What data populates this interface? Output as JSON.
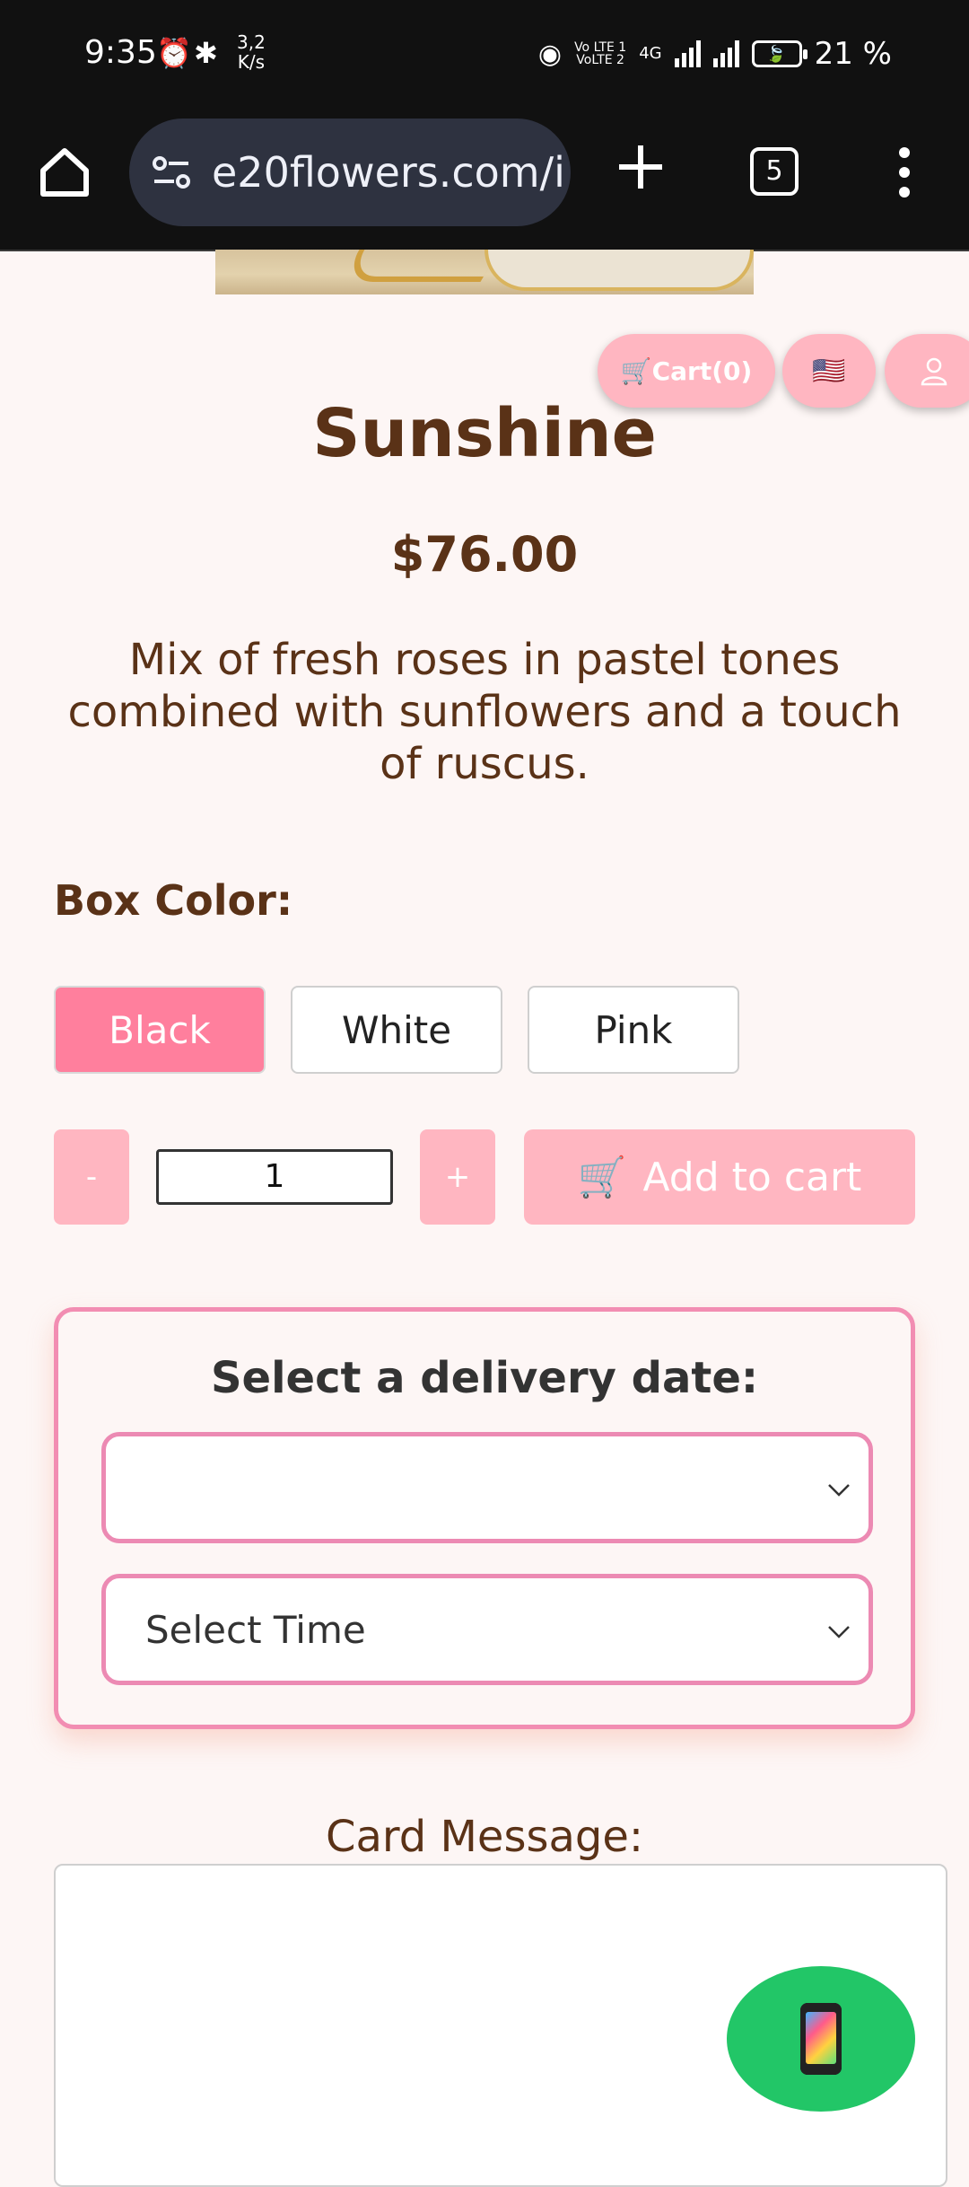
{
  "status_bar": {
    "time": "9:35",
    "speed_value": "3,2",
    "speed_unit": "K/s",
    "volte_top": "Vo LTE 1",
    "volte_bottom": "VoLTE 2",
    "network": "4G",
    "battery_percent": "21 %",
    "icons": [
      "alarm-icon",
      "bluetooth-icon",
      "hotspot-icon",
      "signal-icon",
      "battery-icon"
    ]
  },
  "browser": {
    "url": "e20flowers.com/i",
    "tab_count": "5",
    "icons": [
      "home-icon",
      "site-settings-icon",
      "new-tab-icon",
      "tabs-icon",
      "menu-icon"
    ]
  },
  "header_buttons": {
    "cart_label": "🛒Cart(0)",
    "language_flag": "🇺🇸",
    "account_icon": "user-icon"
  },
  "product": {
    "title": "Sunshine",
    "price": "$76.00",
    "description": "Mix of fresh roses in pastel tones combined with sunflowers and a touch of ruscus."
  },
  "box_color": {
    "label": "Box Color:",
    "options": [
      "Black",
      "White",
      "Pink"
    ],
    "selected": "Black"
  },
  "quantity": {
    "minus_label": "-",
    "value": "1",
    "plus_label": "+"
  },
  "add_to_cart": {
    "icon": "🛒",
    "label": "Add to cart"
  },
  "delivery": {
    "title": "Select a delivery date:",
    "date_value": "",
    "time_placeholder": "Select Time"
  },
  "card_message": {
    "label": "Card Message:",
    "value": ""
  },
  "colors": {
    "page_bg": "#fdf6f5",
    "text_brown": "#5a3217",
    "pill_pink": "#ffb6c1",
    "selected_pink": "#ff7f9d",
    "border_pink": "#ec8ab3",
    "fab_green": "#22c667"
  }
}
